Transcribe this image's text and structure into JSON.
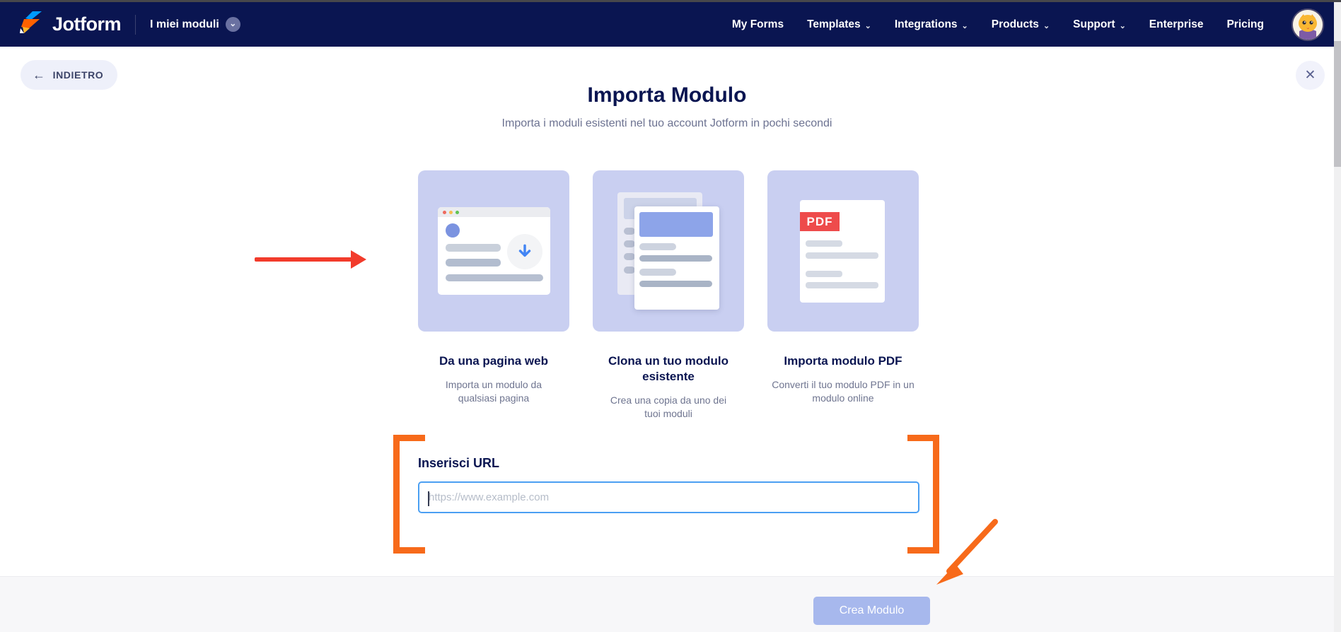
{
  "navbar": {
    "brand": "Jotform",
    "page_title": "I miei moduli",
    "items": [
      {
        "label": "My Forms",
        "chevron": false
      },
      {
        "label": "Templates",
        "chevron": true
      },
      {
        "label": "Integrations",
        "chevron": true
      },
      {
        "label": "Products",
        "chevron": true
      },
      {
        "label": "Support",
        "chevron": true
      },
      {
        "label": "Enterprise",
        "chevron": false
      },
      {
        "label": "Pricing",
        "chevron": false
      }
    ]
  },
  "header": {
    "back_label": "INDIETRO"
  },
  "modal": {
    "title": "Importa Modulo",
    "subtitle": "Importa i moduli esistenti nel tuo account Jotform in pochi secondi",
    "cards": [
      {
        "title": "Da una pagina web",
        "description": "Importa un modulo da qualsiasi pagina"
      },
      {
        "title": "Clona un tuo modulo esistente",
        "description": "Crea una copia da uno dei tuoi moduli"
      },
      {
        "title": "Importa modulo PDF",
        "description": "Converti il tuo modulo PDF in un modulo online",
        "badge": "PDF"
      }
    ],
    "url_section": {
      "label": "Inserisci URL",
      "placeholder": "https://www.example.com",
      "value": ""
    }
  },
  "footer": {
    "create_button": "Crea Modulo"
  },
  "icons": {
    "chevron_down": "⌄",
    "back_arrow": "←",
    "close": "✕"
  },
  "colors": {
    "navbar_navy": "#0a1551",
    "card_background": "#c9cff1",
    "input_focus_blue": "#4b9ff2",
    "annotation_orange": "#f76a1a",
    "annotation_red": "#f23b2b",
    "pdf_red": "#ee4b4b",
    "create_button_blue": "#a7b8ed"
  }
}
